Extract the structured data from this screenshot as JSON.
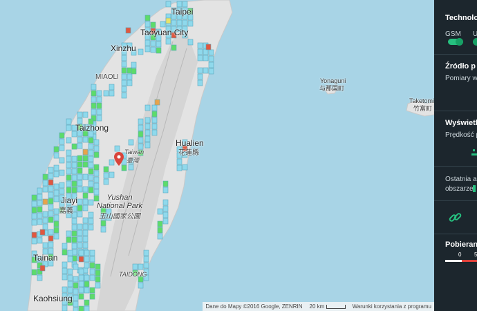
{
  "map": {
    "cities": [
      {
        "key": "taipei",
        "name": "Taipei"
      },
      {
        "key": "taoyuan",
        "name": "Taoyuan City"
      },
      {
        "key": "xinzhu",
        "name": "Xinzhu"
      },
      {
        "key": "miaoli",
        "name": "MIAOLI"
      },
      {
        "key": "taizhong",
        "name": "Taizhong"
      },
      {
        "key": "taiwan",
        "name": "Taiwan",
        "sub": "臺灣"
      },
      {
        "key": "hualien",
        "name": "Hualien",
        "sub": "花蓮縣"
      },
      {
        "key": "jiayi",
        "name": "Jiayi",
        "sub": "嘉義"
      },
      {
        "key": "tainan",
        "name": "Tainan"
      },
      {
        "key": "kaohsiung",
        "name": "Kaohsiung"
      },
      {
        "key": "taidong",
        "name": "TAIDONG"
      }
    ],
    "park": {
      "line1": "Yushan",
      "line2": "National Park",
      "sub": "玉山國家公園"
    },
    "islands": [
      {
        "name": "Yonaguni",
        "sub": "与那国町"
      },
      {
        "name": "Taketomi",
        "sub": "竹富町"
      }
    ],
    "attribution": {
      "data": "Dane do Mapy ©2016 Google, ZENRIN",
      "scale": "20 km",
      "terms": "Warunki korzystania z programu"
    }
  },
  "panel": {
    "technology": {
      "title": "Technolo",
      "gsm": "GSM",
      "umts": "U"
    },
    "source": {
      "title": "Źródło p",
      "desc": "Pomiary w"
    },
    "display": {
      "title": "Wyświetl",
      "desc": "Prędkość p"
    },
    "last": {
      "line1": "Ostatnia a",
      "line2": "obszarze"
    },
    "download": {
      "title": "Pobieran",
      "min": "0",
      "next": "5"
    }
  },
  "colors": {
    "accent": "#26c07f",
    "tile_cyan": "#8fd9ec",
    "tile_green": "#5edb6a",
    "tile_red": "#e0573f",
    "tile_orange": "#e8a34a",
    "tile_yellow": "#e8e36a",
    "pin": "#d9453b",
    "panel_bg": "#1c262d"
  }
}
